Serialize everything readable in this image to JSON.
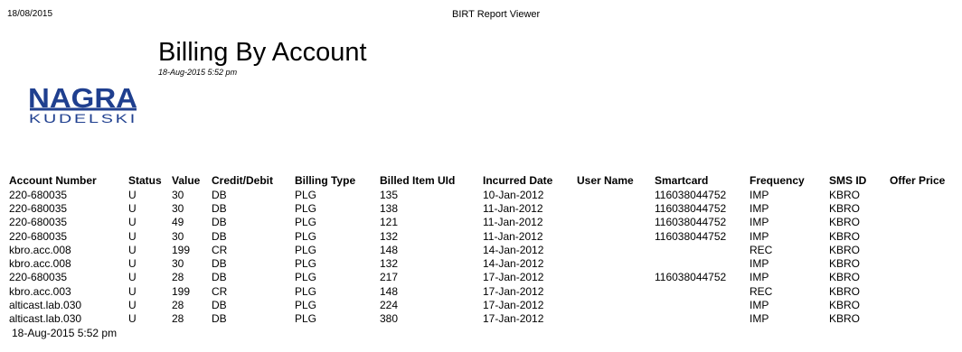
{
  "header": {
    "date": "18/08/2015",
    "app_title": "BIRT Report Viewer"
  },
  "report": {
    "title": "Billing By Account",
    "timestamp": "18-Aug-2015 5:52 pm",
    "logo": {
      "line1": "NAGRA",
      "line2": "KUDELSKI",
      "color": "#1f3f8f"
    }
  },
  "table": {
    "columns": [
      "Account Number",
      "Status",
      "Value",
      "Credit/Debit",
      "Billing Type",
      "Billed Item UId",
      "Incurred Date",
      "User Name",
      "Smartcard",
      "Frequency",
      "SMS ID",
      "Offer Price"
    ],
    "rows": [
      [
        "220-680035",
        "U",
        "30",
        "DB",
        "PLG",
        "135",
        "10-Jan-2012",
        "",
        "116038044752",
        "IMP",
        "KBRO",
        ""
      ],
      [
        "220-680035",
        "U",
        "30",
        "DB",
        "PLG",
        "138",
        "11-Jan-2012",
        "",
        "116038044752",
        "IMP",
        "KBRO",
        ""
      ],
      [
        "220-680035",
        "U",
        "49",
        "DB",
        "PLG",
        "121",
        "11-Jan-2012",
        "",
        "116038044752",
        "IMP",
        "KBRO",
        ""
      ],
      [
        "220-680035",
        "U",
        "30",
        "DB",
        "PLG",
        "132",
        "11-Jan-2012",
        "",
        "116038044752",
        "IMP",
        "KBRO",
        ""
      ],
      [
        "kbro.acc.008",
        "U",
        "199",
        "CR",
        "PLG",
        "148",
        "14-Jan-2012",
        "",
        "",
        "REC",
        "KBRO",
        ""
      ],
      [
        "kbro.acc.008",
        "U",
        "30",
        "DB",
        "PLG",
        "132",
        "14-Jan-2012",
        "",
        "",
        "IMP",
        "KBRO",
        ""
      ],
      [
        "220-680035",
        "U",
        "28",
        "DB",
        "PLG",
        "217",
        "17-Jan-2012",
        "",
        "116038044752",
        "IMP",
        "KBRO",
        ""
      ],
      [
        "kbro.acc.003",
        "U",
        "199",
        "CR",
        "PLG",
        "148",
        "17-Jan-2012",
        "",
        "",
        "REC",
        "KBRO",
        ""
      ],
      [
        "alticast.lab.030",
        "U",
        "28",
        "DB",
        "PLG",
        "224",
        "17-Jan-2012",
        "",
        "",
        "IMP",
        "KBRO",
        ""
      ],
      [
        "alticast.lab.030",
        "U",
        "28",
        "DB",
        "PLG",
        "380",
        "17-Jan-2012",
        "",
        "",
        "IMP",
        "KBRO",
        ""
      ]
    ]
  },
  "footer": {
    "timestamp": "18-Aug-2015 5:52 pm"
  }
}
